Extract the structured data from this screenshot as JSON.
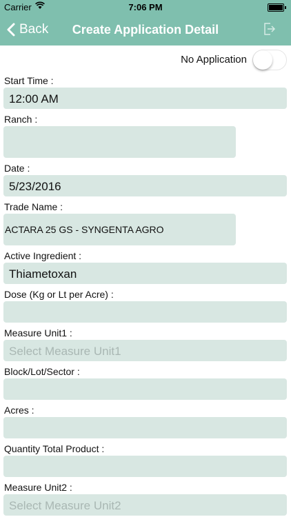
{
  "status": {
    "carrier": "Carrier",
    "time": "7:06 PM"
  },
  "nav": {
    "back_label": "Back",
    "title": "Create Application Detail"
  },
  "toggle": {
    "label": "No Application",
    "on": false
  },
  "form": {
    "start_time_label": "Start Time :",
    "start_time_value": "12:00 AM",
    "ranch_label": "Ranch :",
    "ranch_value": "",
    "date_label": "Date :",
    "date_value": "5/23/2016",
    "trade_name_label": "Trade Name :",
    "trade_name_value": "ACTARA  25 GS - SYNGENTA AGRO",
    "active_ingredient_label": "Active Ingredient :",
    "active_ingredient_value": "Thiametoxan",
    "dose_label": "Dose (Kg or Lt per Acre) :",
    "dose_value": "",
    "measure_unit1_label": "Measure Unit1 :",
    "measure_unit1_placeholder": "Select Measure Unit1",
    "block_label": "Block/Lot/Sector :",
    "block_value": "",
    "acres_label": "Acres :",
    "acres_value": "",
    "quantity_label": "Quantity Total Product :",
    "quantity_value": "",
    "measure_unit2_label": "Measure Unit2 :",
    "measure_unit2_placeholder": "Select Measure Unit2"
  }
}
